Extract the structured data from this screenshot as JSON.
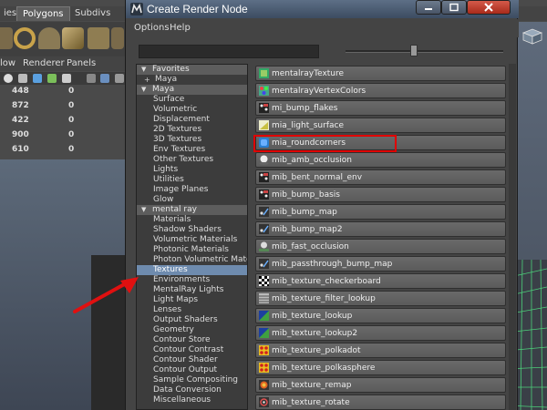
{
  "background": {
    "shelf_tabs": [
      "ies",
      "Polygons",
      "Subdivs"
    ],
    "menus": [
      "low",
      "Renderer",
      "Panels"
    ],
    "stats": [
      {
        "a": "448",
        "b": "0"
      },
      {
        "a": "872",
        "b": "0"
      },
      {
        "a": "422",
        "b": "0"
      },
      {
        "a": "900",
        "b": "0"
      },
      {
        "a": "610",
        "b": "0"
      }
    ]
  },
  "window": {
    "title": "Create Render Node",
    "menus": {
      "options": "Options",
      "help": "Help"
    }
  },
  "tree": [
    {
      "label": "Favorites",
      "kind": "header"
    },
    {
      "label": "Maya",
      "kind": "sub"
    },
    {
      "label": "Maya",
      "kind": "header"
    },
    {
      "label": "Surface",
      "kind": "item"
    },
    {
      "label": "Volumetric",
      "kind": "item"
    },
    {
      "label": "Displacement",
      "kind": "item"
    },
    {
      "label": "2D Textures",
      "kind": "item"
    },
    {
      "label": "3D Textures",
      "kind": "item"
    },
    {
      "label": "Env Textures",
      "kind": "item"
    },
    {
      "label": "Other Textures",
      "kind": "item"
    },
    {
      "label": "Lights",
      "kind": "item"
    },
    {
      "label": "Utilities",
      "kind": "item"
    },
    {
      "label": "Image Planes",
      "kind": "item"
    },
    {
      "label": "Glow",
      "kind": "item"
    },
    {
      "label": "mental ray",
      "kind": "header"
    },
    {
      "label": "Materials",
      "kind": "item"
    },
    {
      "label": "Shadow Shaders",
      "kind": "item"
    },
    {
      "label": "Volumetric Materials",
      "kind": "item"
    },
    {
      "label": "Photonic Materials",
      "kind": "item"
    },
    {
      "label": "Photon Volumetric Materi...",
      "kind": "item"
    },
    {
      "label": "Textures",
      "kind": "item",
      "selected": true
    },
    {
      "label": "Environments",
      "kind": "item"
    },
    {
      "label": "MentalRay Lights",
      "kind": "item"
    },
    {
      "label": "Light Maps",
      "kind": "item"
    },
    {
      "label": "Lenses",
      "kind": "item"
    },
    {
      "label": "Output Shaders",
      "kind": "item"
    },
    {
      "label": "Geometry",
      "kind": "item"
    },
    {
      "label": "Contour Store",
      "kind": "item"
    },
    {
      "label": "Contour Contrast",
      "kind": "item"
    },
    {
      "label": "Contour Shader",
      "kind": "item"
    },
    {
      "label": "Contour Output",
      "kind": "item"
    },
    {
      "label": "Sample Compositing",
      "kind": "item"
    },
    {
      "label": "Data Conversion",
      "kind": "item"
    },
    {
      "label": "Miscellaneous",
      "kind": "item"
    }
  ],
  "nodes": [
    {
      "label": "mentalrayTexture",
      "icon": "texture-icon"
    },
    {
      "label": "mentalrayVertexColors",
      "icon": "vertex-colors-icon"
    },
    {
      "label": "mi_bump_flakes",
      "icon": "bump-icon"
    },
    {
      "label": "mia_light_surface",
      "icon": "light-surface-icon"
    },
    {
      "label": "mia_roundcorners",
      "icon": "roundcorners-icon",
      "highlighted": true
    },
    {
      "label": "mib_amb_occlusion",
      "icon": "occlusion-icon"
    },
    {
      "label": "mib_bent_normal_env",
      "icon": "bump-icon"
    },
    {
      "label": "mib_bump_basis",
      "icon": "bump-icon"
    },
    {
      "label": "mib_bump_map",
      "icon": "bump-map-icon"
    },
    {
      "label": "mib_bump_map2",
      "icon": "bump-map-icon"
    },
    {
      "label": "mib_fast_occlusion",
      "icon": "fast-occlusion-icon"
    },
    {
      "label": "mib_passthrough_bump_map",
      "icon": "bump-map-icon"
    },
    {
      "label": "mib_texture_checkerboard",
      "icon": "checker-icon"
    },
    {
      "label": "mib_texture_filter_lookup",
      "icon": "filter-icon"
    },
    {
      "label": "mib_texture_lookup",
      "icon": "lookup-icon"
    },
    {
      "label": "mib_texture_lookup2",
      "icon": "lookup-icon"
    },
    {
      "label": "mib_texture_polkadot",
      "icon": "polka-icon"
    },
    {
      "label": "mib_texture_polkasphere",
      "icon": "polka-icon"
    },
    {
      "label": "mib_texture_remap",
      "icon": "remap-icon"
    },
    {
      "label": "mib_texture_rotate",
      "icon": "rotate-icon"
    }
  ],
  "colors": {
    "selected_bg": "#6e8bae",
    "highlight_border": "#e00000",
    "arrow": "#e01010"
  }
}
